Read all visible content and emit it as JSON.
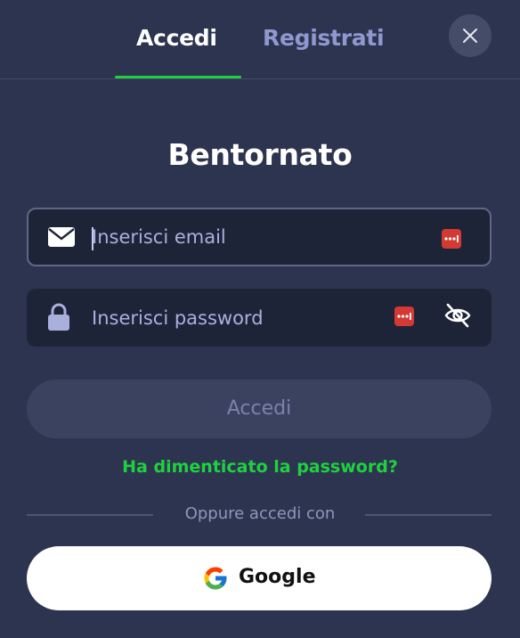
{
  "tabs": {
    "login": "Accedi",
    "register": "Registrati",
    "active": "login"
  },
  "title": "Bentornato",
  "email": {
    "placeholder": "Inserisci email",
    "value": ""
  },
  "password": {
    "placeholder": "Inserisci password",
    "value": ""
  },
  "submit_label": "Accedi",
  "forgot_label": "Ha dimenticato la password?",
  "divider_label": "Oppure accedi con",
  "google_label": "Google",
  "icons": {
    "close": "close-icon",
    "email": "envelope-icon",
    "password": "lock-icon",
    "password_manager": "password-manager-icon",
    "visibility": "eye-off-icon",
    "google": "google-icon"
  },
  "colors": {
    "background": "#2d3450",
    "accent": "#1fd13f",
    "inactive_tab": "#8f98cf",
    "input_bg": "#1e2438",
    "disabled_button": "#3b4260"
  }
}
